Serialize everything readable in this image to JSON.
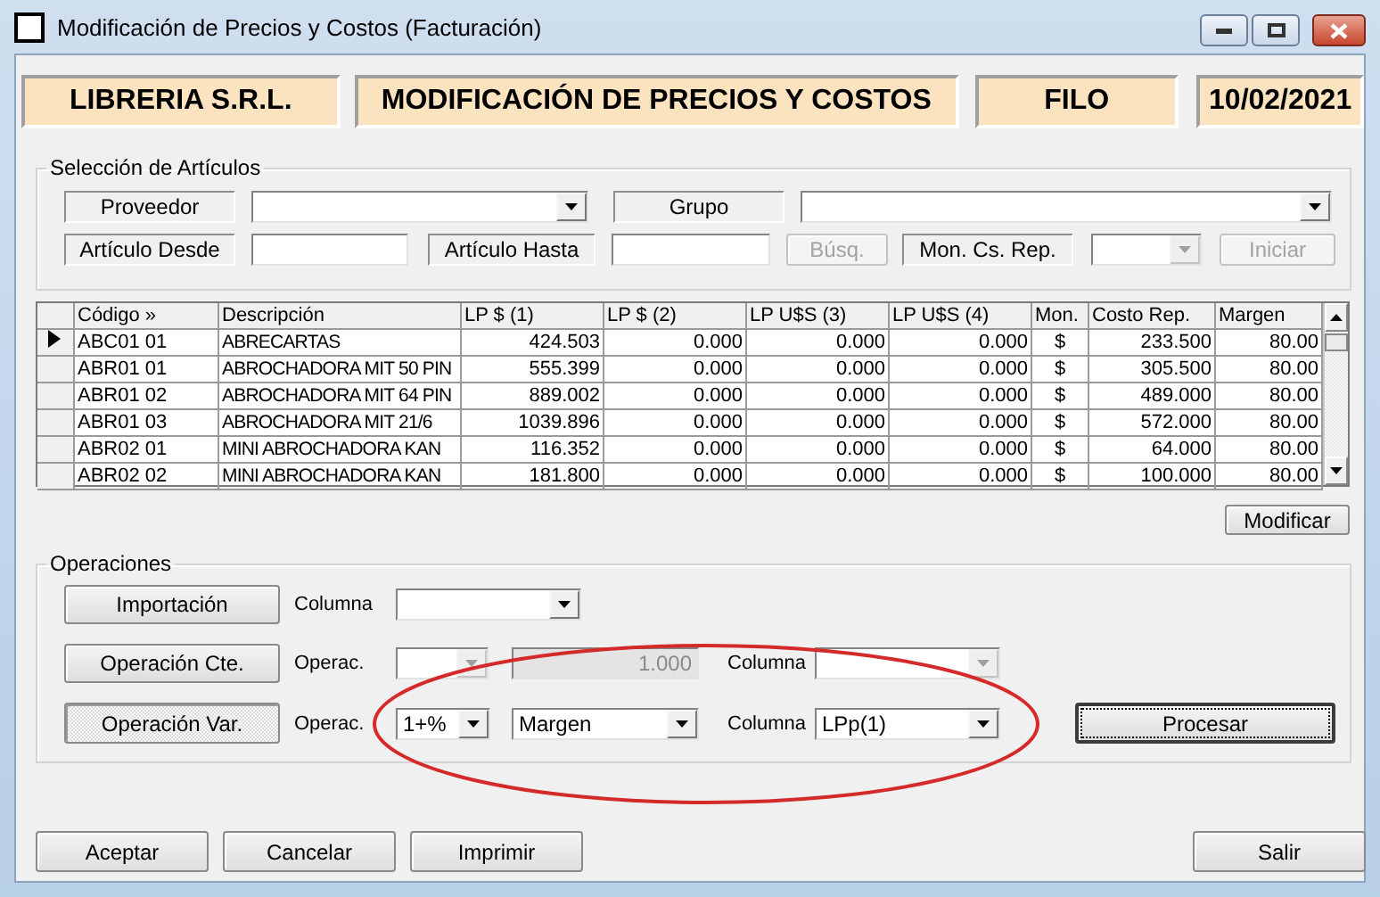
{
  "window": {
    "title": "Modificación de Precios y Costos (Facturación)"
  },
  "header": [
    "LIBRERIA S.R.L.",
    "MODIFICACIÓN DE PRECIOS Y COSTOS",
    "FILO",
    "10/02/2021"
  ],
  "selection": {
    "title": "Selección de Artículos",
    "rows": [
      {
        "items": [
          {
            "kind": "label",
            "text": "Proveedor"
          },
          {
            "kind": "combo",
            "disabled": false
          },
          {
            "kind": "label",
            "text": "Grupo"
          },
          {
            "kind": "combo",
            "disabled": false
          }
        ]
      },
      {
        "items": [
          {
            "kind": "label",
            "text": "Artículo Desde"
          },
          {
            "kind": "input",
            "disabled": false
          },
          {
            "kind": "label",
            "text": "Artículo Hasta"
          },
          {
            "kind": "input",
            "disabled": false
          },
          {
            "kind": "button",
            "text": "Búsq.",
            "disabled": true
          },
          {
            "kind": "label",
            "text": "Mon. Cs. Rep."
          },
          {
            "kind": "combo",
            "disabled": true
          },
          {
            "kind": "button",
            "text": "Iniciar",
            "disabled": true
          }
        ]
      }
    ]
  },
  "table": {
    "columns": [
      "Código »",
      "Descripción",
      "LP $ (1)",
      "LP $ (2)",
      "LP U$S (3)",
      "LP U$S (4)",
      "Mon.",
      "Costo Rep.",
      "Margen"
    ],
    "rows": [
      {
        "selected": true,
        "cells": [
          "ABC01 01",
          "ABRECARTAS",
          "424.503",
          "0.000",
          "0.000",
          "0.000",
          "$",
          "233.500",
          "80.00"
        ]
      },
      {
        "selected": false,
        "cells": [
          "ABR01 01",
          "ABROCHADORA MIT 50 PIN",
          "555.399",
          "0.000",
          "0.000",
          "0.000",
          "$",
          "305.500",
          "80.00"
        ]
      },
      {
        "selected": false,
        "cells": [
          "ABR01 02",
          "ABROCHADORA MIT 64 PIN",
          "889.002",
          "0.000",
          "0.000",
          "0.000",
          "$",
          "489.000",
          "80.00"
        ]
      },
      {
        "selected": false,
        "cells": [
          "ABR01 03",
          "ABROCHADORA MIT 21/6",
          "1039.896",
          "0.000",
          "0.000",
          "0.000",
          "$",
          "572.000",
          "80.00"
        ]
      },
      {
        "selected": false,
        "cells": [
          "ABR02 01",
          "MINI ABROCHADORA KAN",
          "116.352",
          "0.000",
          "0.000",
          "0.000",
          "$",
          "64.000",
          "80.00"
        ]
      },
      {
        "selected": false,
        "cells": [
          "ABR02 02",
          "MINI ABROCHADORA KAN",
          "181.800",
          "0.000",
          "0.000",
          "0.000",
          "$",
          "100.000",
          "80.00"
        ]
      }
    ]
  },
  "modify_button": "Modificar",
  "operations": {
    "title": "Operaciones",
    "rows": [
      {
        "button": {
          "label": "Importación",
          "selected": false
        },
        "items": [
          {
            "kind": "label",
            "text": "Columna"
          },
          {
            "kind": "combo",
            "disabled": false
          }
        ]
      },
      {
        "button": {
          "label": "Operación Cte.",
          "selected": false
        },
        "items": [
          {
            "kind": "label",
            "text": "Operac."
          },
          {
            "kind": "combo",
            "disabled": true
          },
          {
            "kind": "input",
            "value": "1.000",
            "disabled": true
          },
          {
            "kind": "label",
            "text": "Columna"
          },
          {
            "kind": "combo",
            "disabled": true
          }
        ]
      },
      {
        "button": {
          "label": "Operación Var.",
          "selected": true
        },
        "items": [
          {
            "kind": "label",
            "text": "Operac."
          },
          {
            "kind": "combo",
            "value": "1+%",
            "disabled": false
          },
          {
            "kind": "combo",
            "value": "Margen",
            "disabled": false
          },
          {
            "kind": "label",
            "text": "Columna"
          },
          {
            "kind": "combo",
            "value": "LPp(1)",
            "disabled": false
          },
          {
            "kind": "button",
            "text": "Procesar",
            "disabled": false
          }
        ]
      }
    ]
  },
  "footer": {
    "left": [
      "Aceptar",
      "Cancelar",
      "Imprimir"
    ],
    "right": "Salir"
  }
}
